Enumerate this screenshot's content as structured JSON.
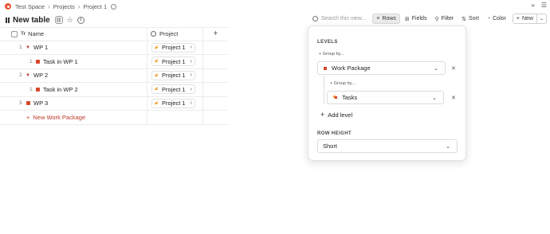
{
  "breadcrumb": {
    "workspace": "Test Space",
    "projects": "Projects",
    "project": "Project 1"
  },
  "topbar_right": {
    "expand": "»",
    "menu": "☰"
  },
  "page": {
    "title": "New table"
  },
  "toolbar": {
    "search_placeholder": "Search this view...",
    "rows_label": "Rows",
    "fields_label": "Fields",
    "filter_label": "Filter",
    "sort_label": "Sort",
    "color_label": "Color",
    "new_label": "New"
  },
  "table": {
    "columns": {
      "name": "Name",
      "project": "Project",
      "add": "+"
    },
    "rows": [
      {
        "num": "1",
        "name": "WP 1",
        "project": "Project 1"
      },
      {
        "num": "1",
        "name": "Task in WP 1",
        "project": "Project 1"
      },
      {
        "num": "2",
        "name": "WP 2",
        "project": "Project 1"
      },
      {
        "num": "1",
        "name": "Task in WP 2",
        "project": "Project 1"
      },
      {
        "num": "3",
        "name": "WP 3",
        "project": "Project 1"
      }
    ],
    "new_row_label": "New Work Package"
  },
  "rows_panel": {
    "levels_heading": "LEVELS",
    "group_by_1": "Group by...",
    "level_1_value": "Work Package",
    "group_by_2": "Group by...",
    "level_2_value": "Tasks",
    "add_level": "Add level",
    "row_height_heading": "ROW HEIGHT",
    "row_height_value": "Short"
  },
  "colors": {
    "accent_red": "#d6452a",
    "project_orange": "#f0a030",
    "brand_logo": "#e8552f"
  }
}
